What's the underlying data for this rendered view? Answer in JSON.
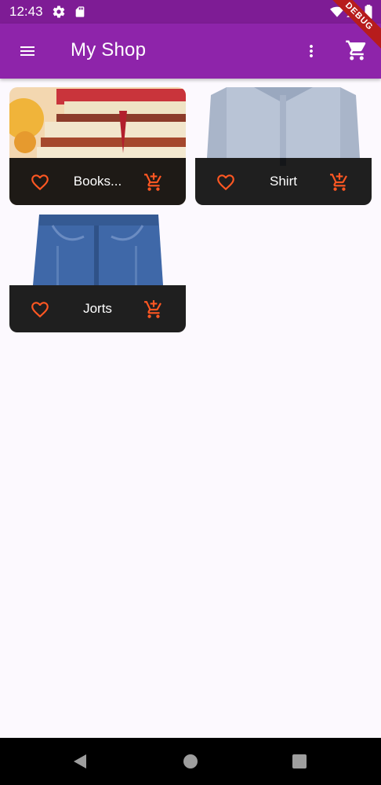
{
  "status_bar": {
    "time": "12:43"
  },
  "app_bar": {
    "title": "My Shop",
    "debug_label": "DEBUG"
  },
  "products": [
    {
      "name": "Books...",
      "image": "books"
    },
    {
      "name": "Shirt",
      "image": "shirt"
    },
    {
      "name": "Jorts",
      "image": "jorts"
    }
  ],
  "colors": {
    "app_bar": "#8e24aa",
    "status_bar": "#7e1c95",
    "accent": "#ff5722",
    "background": "#fcf9fe"
  },
  "icons": [
    "menu-icon",
    "more-vert-icon",
    "shopping-cart-icon",
    "favorite-border-icon",
    "add-shopping-cart-icon",
    "settings-icon",
    "sd-card-icon",
    "wifi-icon",
    "signal-icon",
    "battery-icon",
    "nav-back-icon",
    "nav-home-icon",
    "nav-recents-icon"
  ]
}
